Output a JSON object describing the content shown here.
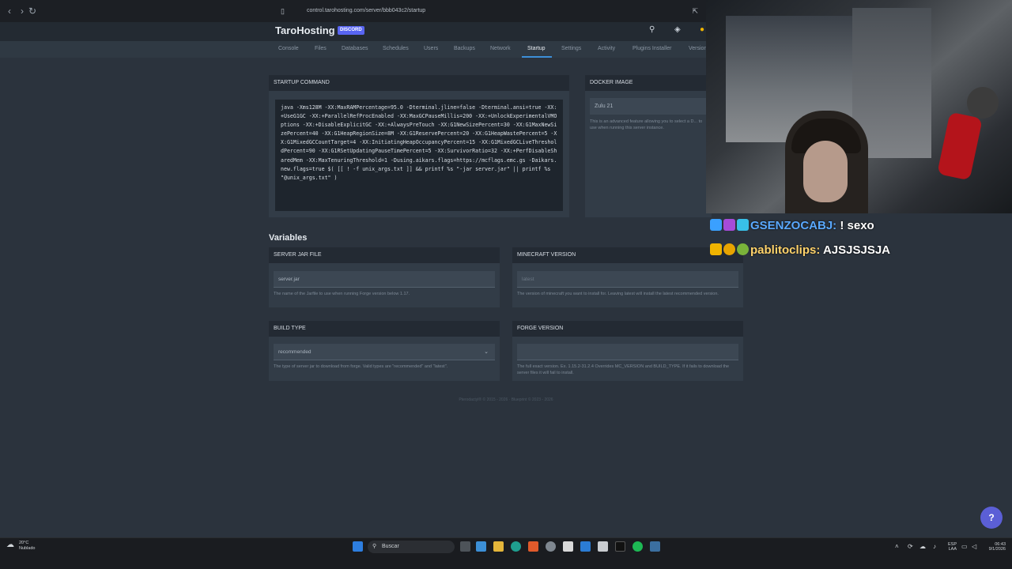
{
  "browser": {
    "url": "control.tarohosting.com/server/bbb043c2/startup"
  },
  "app": {
    "brand": "TaroHosting",
    "discord_label": "DISCORD"
  },
  "tabs": [
    {
      "label": "Console"
    },
    {
      "label": "Files"
    },
    {
      "label": "Databases"
    },
    {
      "label": "Schedules"
    },
    {
      "label": "Users"
    },
    {
      "label": "Backups"
    },
    {
      "label": "Network"
    },
    {
      "label": "Startup"
    },
    {
      "label": "Settings"
    },
    {
      "label": "Activity"
    },
    {
      "label": "Plugins Installer"
    },
    {
      "label": "Version"
    }
  ],
  "startup": {
    "heading": "STARTUP COMMAND",
    "command": "java -Xms128M -XX:MaxRAMPercentage=95.0 -Dterminal.jline=false -Dterminal.ansi=true -XX:+UseG1GC -XX:+ParallelRefProcEnabled -XX:MaxGCPauseMillis=200 -XX:+UnlockExperimentalVMOptions -XX:+DisableExplicitGC -XX:+AlwaysPreTouch -XX:G1NewSizePercent=30 -XX:G1MaxNewSizePercent=40 -XX:G1HeapRegionSize=8M -XX:G1ReservePercent=20 -XX:G1HeapWastePercent=5 -XX:G1MixedGCCountTarget=4 -XX:InitiatingHeapOccupancyPercent=15 -XX:G1MixedGCLiveThresholdPercent=90 -XX:G1RSetUpdatingPauseTimePercent=5 -XX:SurvivorRatio=32 -XX:+PerfDisableSharedMem -XX:MaxTenuringThreshold=1 -Dusing.aikars.flags=https://mcflags.emc.gs -Daikars.new.flags=true $( [[ ! -f unix_args.txt ]] && printf %s \"-jar server.jar\" || printf %s \"@unix_args.txt\" )"
  },
  "docker": {
    "heading": "DOCKER IMAGE",
    "value": "Zulu 21",
    "hint": "This is an advanced feature allowing you to select a D... to use when running this server instance."
  },
  "variables": {
    "title": "Variables",
    "server_jar": {
      "heading": "SERVER JAR FILE",
      "value": "server.jar",
      "hint": "The name of the Jarfile to use when running Forge version below 1.17."
    },
    "minecraft_version": {
      "heading": "MINECRAFT VERSION",
      "value": "latest",
      "hint": "The version of minecraft you want to install for. Leaving latest will install the latest recommended version."
    },
    "build_type": {
      "heading": "BUILD TYPE",
      "value": "recommended",
      "hint": "The type of server jar to download from forge. Valid types are \"recommended\" and \"latest\"."
    },
    "forge_version": {
      "heading": "FORGE VERSION",
      "value": "",
      "hint": "The full exact version. Ex. 1.15.2-31.2.4 Overrides MC_VERSION and BUILD_TYPE. If it fails to download the server files it will fail to install."
    }
  },
  "footer": "Pterodactyl® © 2015 - 2026 · Blueprint © 2023 - 2026",
  "chat": [
    {
      "user": "GSENZOCABJ:",
      "message": "! sexo",
      "color": "#5aa9ff"
    },
    {
      "user": "pablitoclips:",
      "message": "AJSJSJSJA",
      "color": "#ffd36b"
    }
  ],
  "help_label": "?",
  "taskbar": {
    "weather_temp": "20°C",
    "weather_desc": "Nublado",
    "search_label": "Buscar",
    "lang": "ESP",
    "lang_sub": "LAA",
    "time": "06:43",
    "date": "9/1/2026"
  },
  "colors": {
    "accent": "#3d8fd8",
    "discord": "#5865f2",
    "help": "#5b5fd6"
  }
}
